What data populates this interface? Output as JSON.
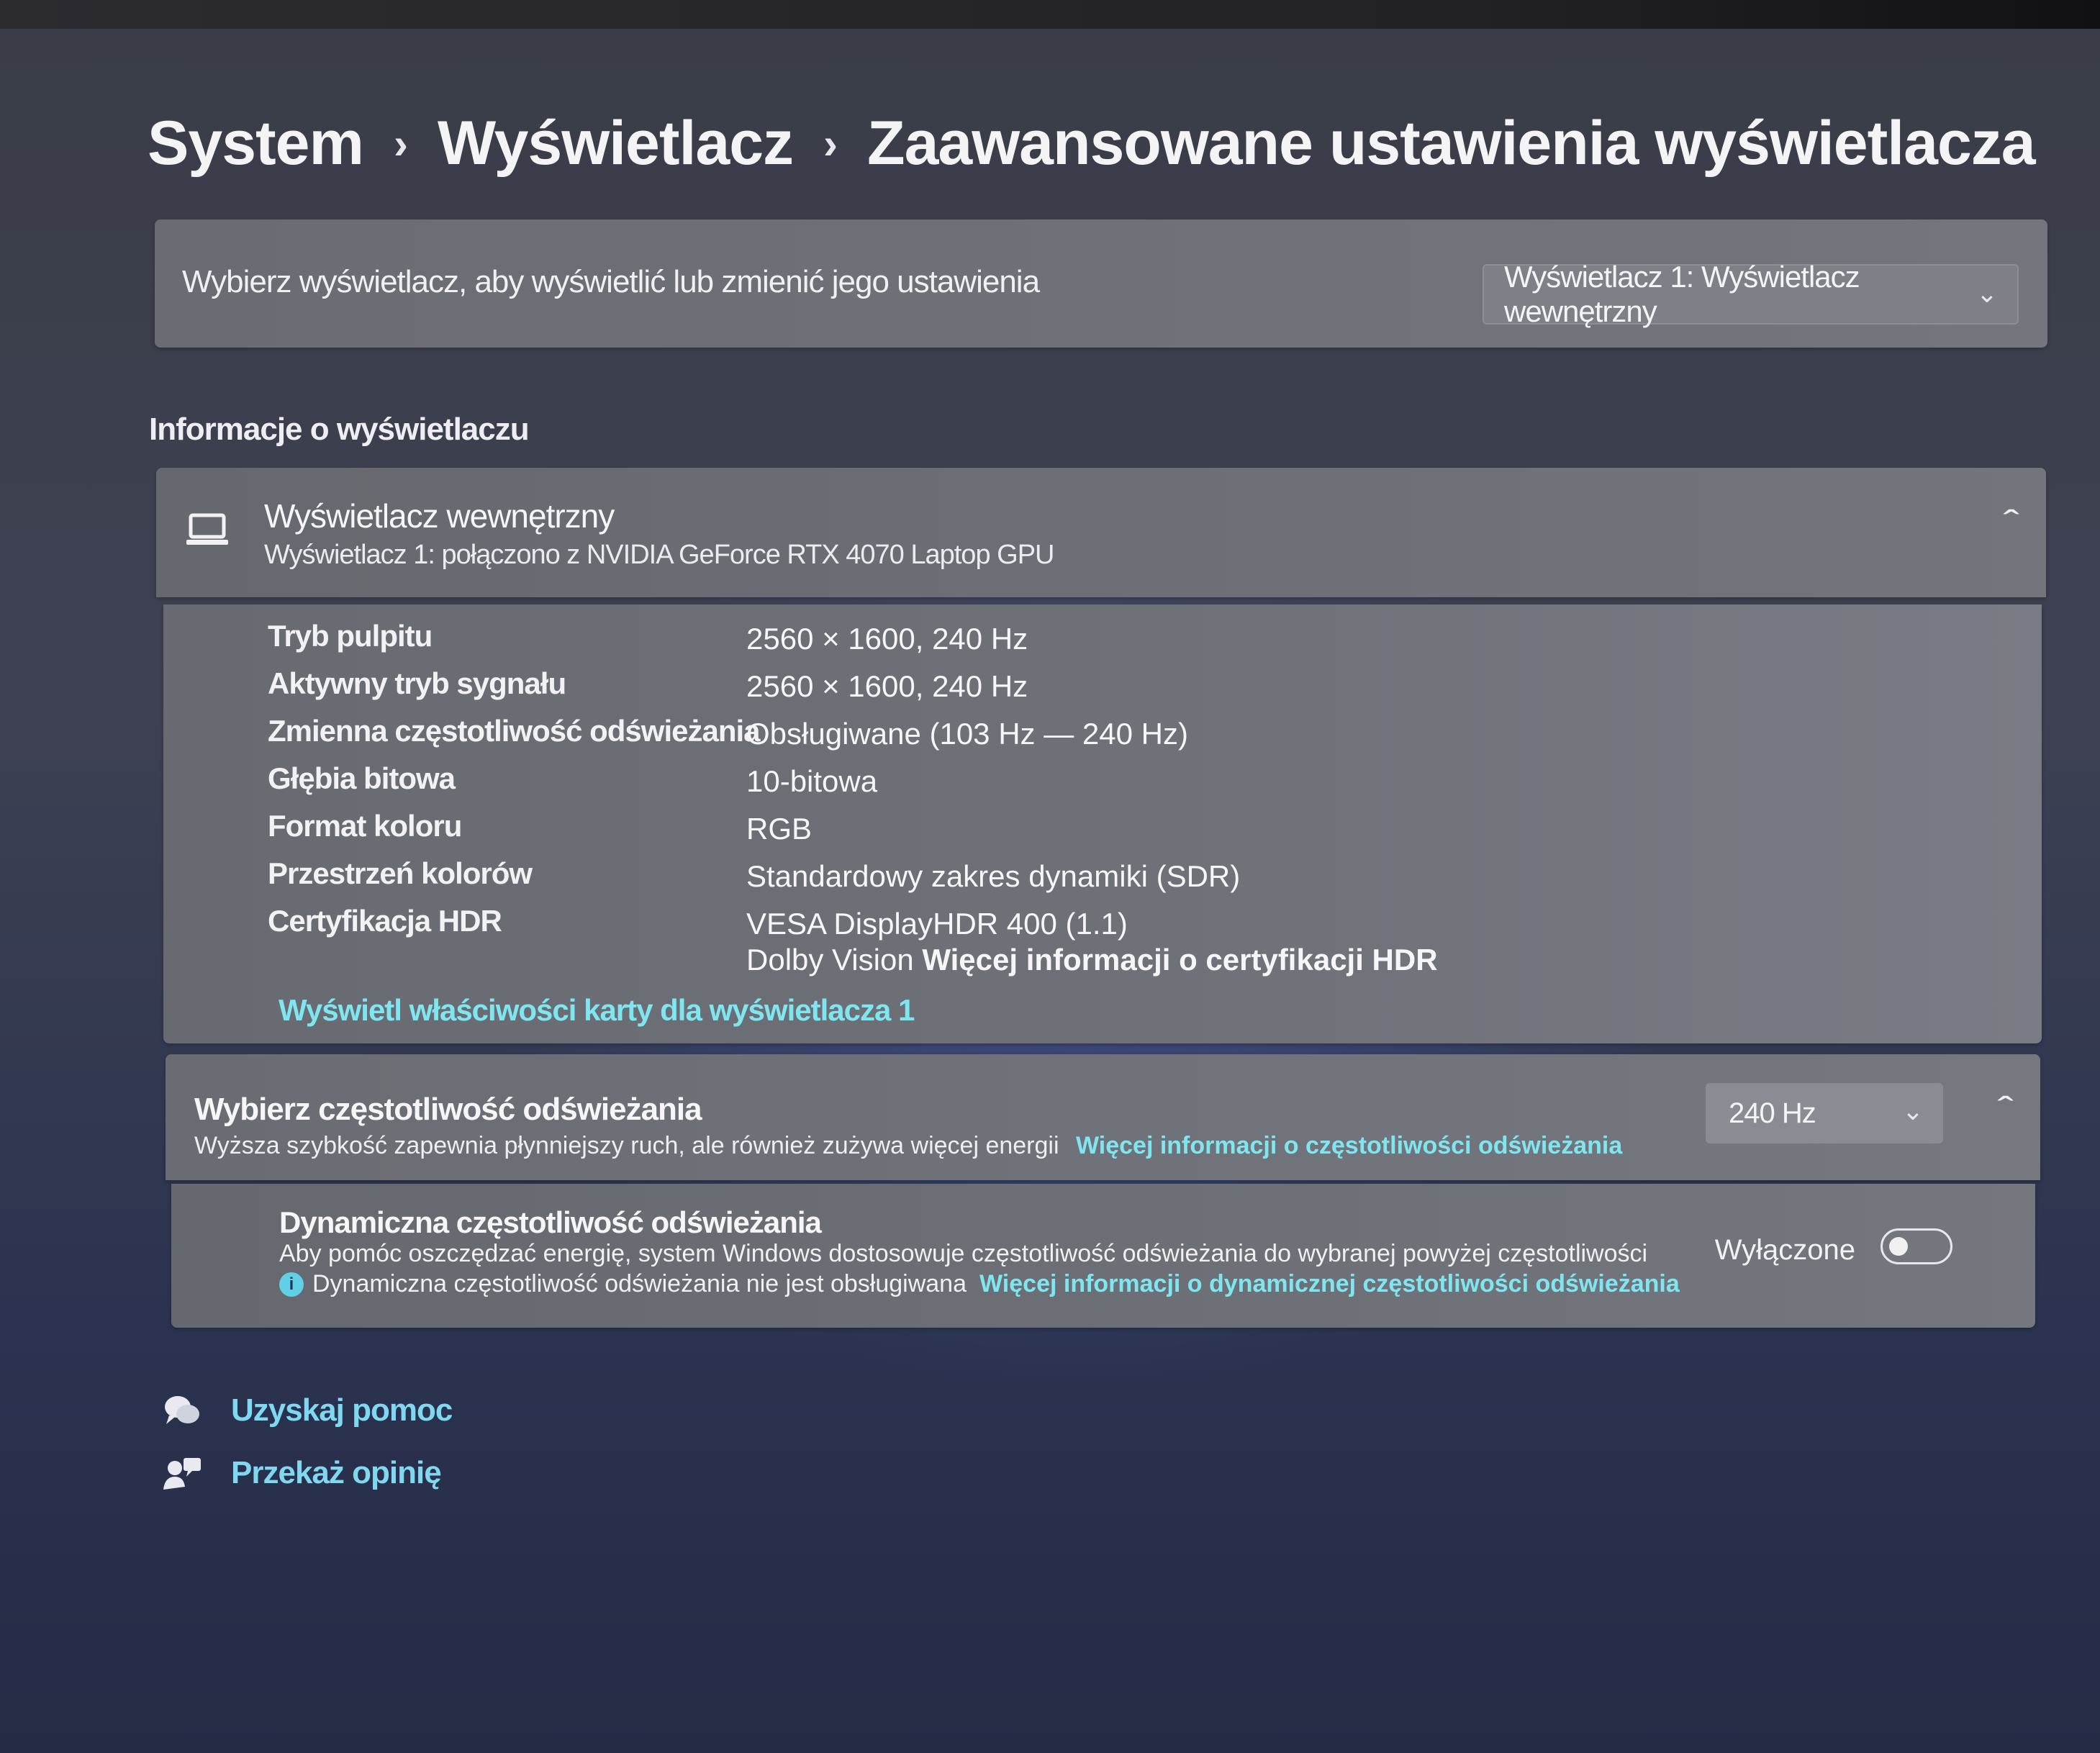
{
  "breadcrumb": {
    "items": [
      "System",
      "Wyświetlacz",
      "Zaawansowane ustawienia wyświetlacza"
    ],
    "separator": "›"
  },
  "choose_display": {
    "label": "Wybierz wyświetlacz, aby wyświetlić lub zmienić jego ustawienia",
    "selected": "Wyświetlacz 1: Wyświetlacz wewnętrzny"
  },
  "info_section": {
    "title": "Informacje o wyświetlaczu",
    "display_name": "Wyświetlacz wewnętrzny",
    "display_sub": "Wyświetlacz 1: połączono z NVIDIA GeForce RTX 4070 Laptop GPU",
    "icon": "laptop-icon",
    "properties": [
      {
        "name": "Tryb pulpitu",
        "value": "2560 × 1600, 240 Hz"
      },
      {
        "name": "Aktywny tryb sygnału",
        "value": "2560 × 1600, 240 Hz"
      },
      {
        "name": "Zmienna częstotliwość odświeżania",
        "value": "Obsługiwane (103 Hz — 240 Hz)"
      },
      {
        "name": "Głębia bitowa",
        "value": "10-bitowa"
      },
      {
        "name": "Format koloru",
        "value": "RGB"
      },
      {
        "name": "Przestrzeń kolorów",
        "value": "Standardowy zakres dynamiki (SDR)"
      },
      {
        "name": "Certyfikacja HDR",
        "value": "VESA DisplayHDR 400 (1.1)"
      }
    ],
    "hdr_extra": "Dolby Vision",
    "hdr_link": "Więcej informacji o certyfikacji HDR",
    "adapter_link": "Wyświetl właściwości karty dla wyświetlacza 1"
  },
  "refresh": {
    "title": "Wybierz częstotliwość odświeżania",
    "subtitle": "Wyższa szybkość zapewnia płynniejszy ruch, ale również zużywa więcej energii",
    "link": "Więcej informacji o częstotliwości odświeżania",
    "selected": "240 Hz",
    "dynamic_title": "Dynamiczna częstotliwość odświeżania",
    "dynamic_desc": "Aby pomóc oszczędzać energię, system Windows dostosowuje częstotliwość odświeżania do wybranej powyżej częstotliwości",
    "dynamic_note": "Dynamiczna częstotliwość odświeżania nie jest obsługiwana",
    "dynamic_link": "Więcej informacji o dynamicznej częstotliwości odświeżania",
    "toggle_label": "Wyłączone",
    "toggle_on": false
  },
  "footer": {
    "help": "Uzyskaj pomoc",
    "feedback": "Przekaż opinię"
  },
  "colors": {
    "link": "#7fe6f0",
    "card": "#6f717a"
  }
}
